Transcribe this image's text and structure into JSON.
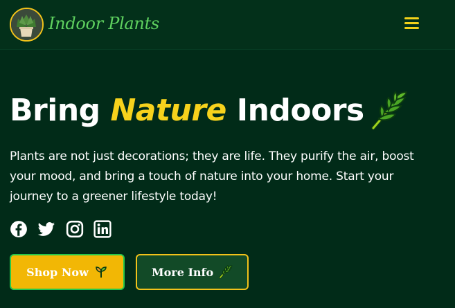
{
  "header": {
    "brand": "Indoor Plants",
    "logo_icon": "potted-plant-icon",
    "menu_icon": "hamburger-menu-icon"
  },
  "hero": {
    "title_part1": "Bring ",
    "title_accent": "Nature",
    "title_part2": " Indoors",
    "title_icon": "leaf-icon",
    "description": "Plants are not just decorations; they are life. They purify the air, boost your mood, and bring a touch of nature into your home. Start your journey to a greener lifestyle today!"
  },
  "socials": [
    {
      "icon": "facebook-icon"
    },
    {
      "icon": "twitter-icon"
    },
    {
      "icon": "instagram-icon"
    },
    {
      "icon": "linkedin-icon"
    }
  ],
  "buttons": {
    "shop_label": "Shop Now",
    "shop_icon": "seedling-icon",
    "more_label": "More Info",
    "more_icon": "leaf-icon"
  },
  "colors": {
    "background": "#012b18",
    "header": "#03301a",
    "accent_yellow": "#f7d21c",
    "brand_green": "#5fd15f",
    "shop_bg": "#f2b705",
    "more_bg": "#124a27"
  }
}
